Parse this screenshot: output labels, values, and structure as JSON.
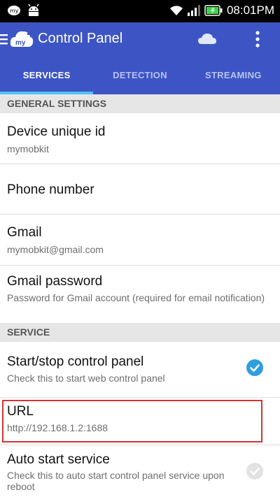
{
  "status_bar": {
    "time": "08:01PM",
    "icons": [
      "mymobkit-notification-icon",
      "android-icon",
      "wifi-icon",
      "signal-icon",
      "battery-charging-icon"
    ]
  },
  "app_bar": {
    "title": "Control Panel",
    "logo_text": "my",
    "icons": [
      "menu-icon",
      "cloud-icon",
      "more-vert-icon"
    ]
  },
  "tabs": [
    {
      "label": "SERVICES",
      "active": true
    },
    {
      "label": "DETECTION",
      "active": false
    },
    {
      "label": "STREAMING",
      "active": false
    }
  ],
  "sections": {
    "general": "GENERAL SETTINGS",
    "service": "SERVICE"
  },
  "prefs": {
    "device_id": {
      "title": "Device unique id",
      "summary": "mymobkit"
    },
    "phone": {
      "title": "Phone number"
    },
    "gmail": {
      "title": "Gmail",
      "summary": "mymobkit@gmail.com"
    },
    "gmail_password": {
      "title": "Gmail password",
      "summary": "Password for Gmail account (required for email notification)"
    },
    "start_stop": {
      "title": "Start/stop control panel",
      "summary": "Check this to start web control panel",
      "checked": true
    },
    "url": {
      "title": "URL",
      "summary": "http://192.168.1.2:1688"
    },
    "auto_start": {
      "title": "Auto start service",
      "summary": "Check this to auto start control panel service upon reboot",
      "checked": false
    }
  },
  "colors": {
    "app_bar": "#3d55c4",
    "tab_indicator": "#4fc3f7",
    "check_on": "#2e9ee0",
    "highlight": "#d63333"
  }
}
